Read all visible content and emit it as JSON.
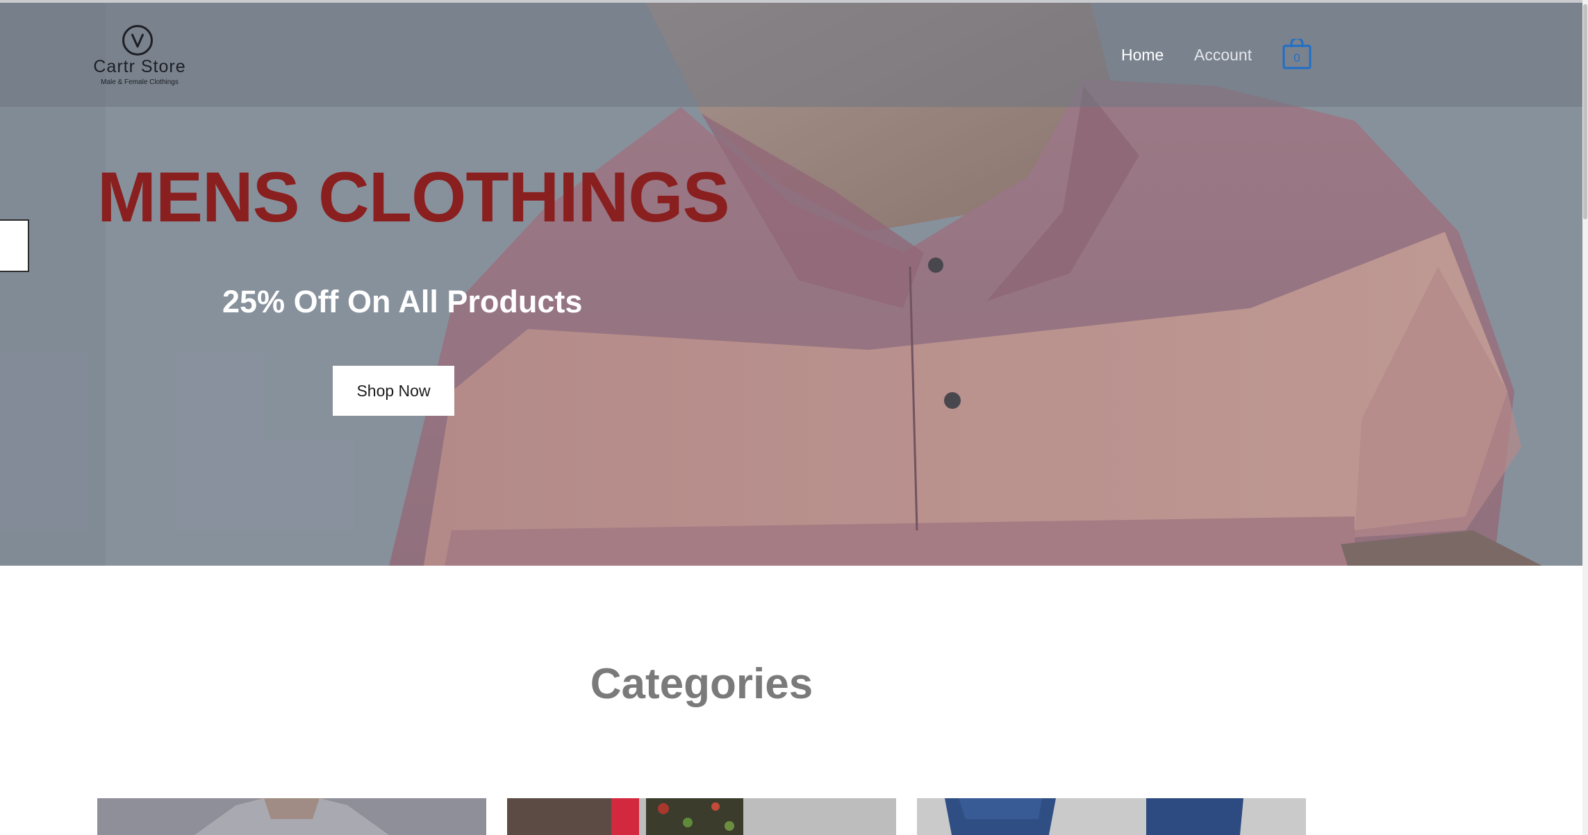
{
  "header": {
    "logo": {
      "name": "Cartr Store",
      "tagline": "Male & Female Clothings",
      "icon": "v-monogram-icon"
    },
    "nav": [
      {
        "label": "Home",
        "active": true
      },
      {
        "label": "Account",
        "active": false
      }
    ],
    "cart": {
      "icon": "shopping-bag-icon",
      "count": "0"
    }
  },
  "hero": {
    "title": "MENS CLOTHINGS",
    "subtitle": "25% Off On All Products",
    "cta_label": "Shop Now",
    "image": "man-in-striped-polo-shirt",
    "colors": {
      "title": "#8a1f1f",
      "subtitle": "#ffffff"
    }
  },
  "categories": {
    "heading": "Categories",
    "items": [
      {
        "image": "grey-shirt-photo"
      },
      {
        "image": "floral-dress-photo"
      },
      {
        "image": "blue-jeans-photo"
      }
    ]
  },
  "colors": {
    "accent": "#1f6fc9",
    "heading_grey": "#7a7a7a"
  }
}
